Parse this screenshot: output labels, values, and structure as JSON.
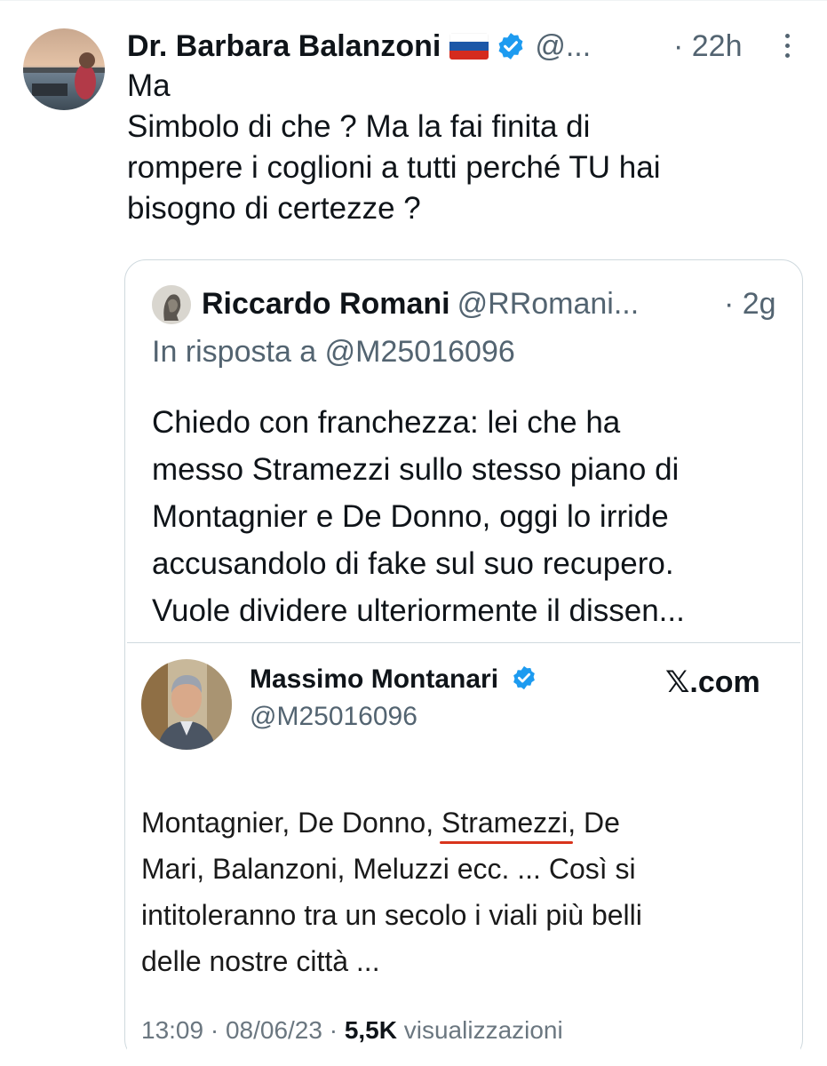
{
  "tweet": {
    "author_name": "Dr. Barbara Balanzoni",
    "handle": "@...",
    "time": "· 22h",
    "text_lines": [
      "Ma",
      "Simbolo di che ? Ma la fai finita di",
      "rompere i coglioni  a tutti perché TU hai",
      "bisogno di certezze ?"
    ]
  },
  "quote": {
    "author_name": "Riccardo Romani",
    "handle": "@RRomani...",
    "time": "· 2g",
    "reply_to": "In risposta a @M25016096",
    "text_lines": [
      "Chiedo con franchezza: lei che ha",
      "messo Stramezzi sullo stesso piano di",
      "Montagnier e De Donno, oggi lo irride",
      "accusandolo di fake sul suo recupero.",
      "Vuole dividere ulteriormente il dissen..."
    ]
  },
  "embedded": {
    "author_name": "Massimo Montanari",
    "handle": "@M25016096",
    "source": "𝕏.com",
    "line1_before": "Montagnier, De Donno, ",
    "line1_underlined": "Stramezzi",
    "line1_after": ", De",
    "line2": "Mari, Balanzoni, Meluzzi  ecc. ...  Così si",
    "line3": "intitoleranno tra un secolo i viali più belli",
    "line4": "delle nostre città ...",
    "meta_time": "13:09 · 08/06/23 · ",
    "meta_views": "5,5K",
    "meta_views_label": " visualizzazioni"
  },
  "colors": {
    "verified_blue": "#1d9bf0",
    "secondary_text": "#536471",
    "underline_red": "#d8341c"
  }
}
